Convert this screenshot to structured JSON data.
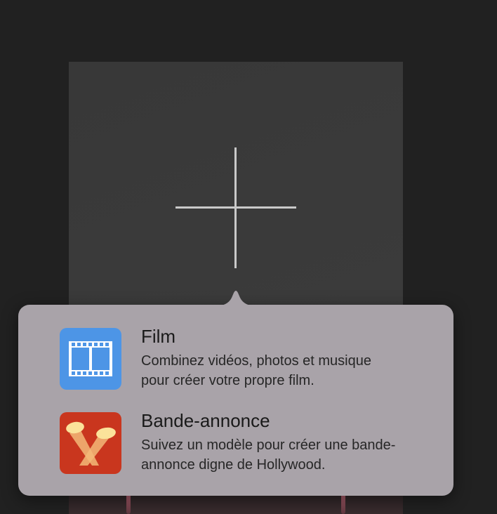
{
  "popover": {
    "items": [
      {
        "title": "Film",
        "description_line1": "Combinez vidéos, photos et musique",
        "description_line2": "pour créer votre propre film.",
        "icon": "film-strip-icon",
        "icon_color": "#4d95e6"
      },
      {
        "title": "Bande-annonce",
        "description_line1": "Suivez un modèle pour créer une bande-",
        "description_line2": "annonce digne de Hollywood.",
        "icon": "spotlights-icon",
        "icon_color": "#c9361e"
      }
    ]
  },
  "tile": {
    "icon": "plus-icon"
  }
}
